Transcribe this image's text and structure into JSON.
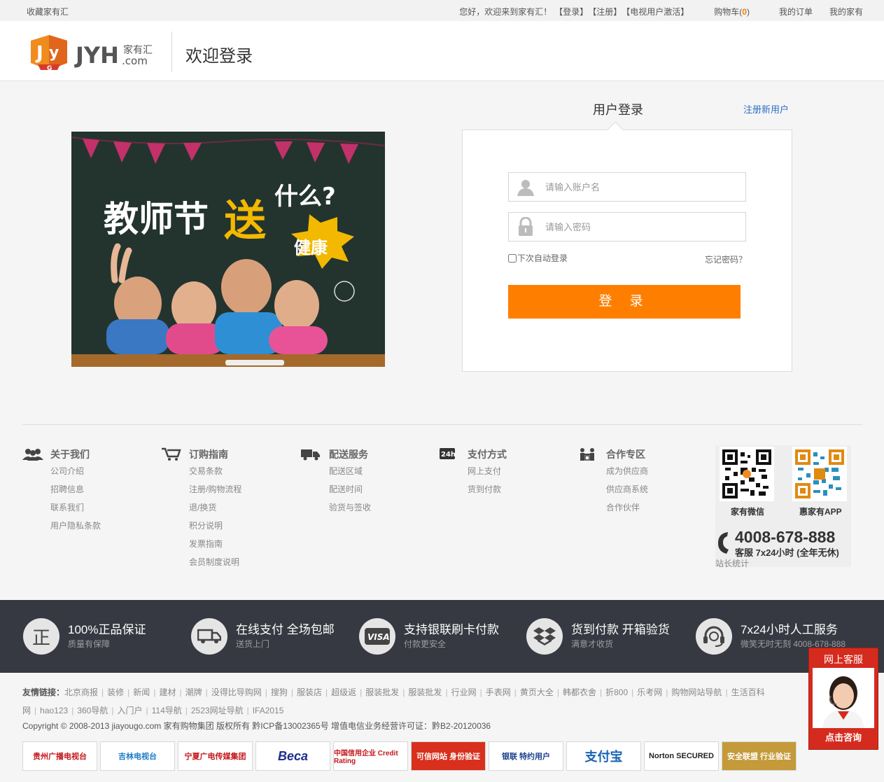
{
  "topbar": {
    "bookmark": "收藏家有汇",
    "greeting": "您好，欢迎来到家有汇！",
    "login": "【登录】",
    "register": "【注册】",
    "tv_activate": "【电视用户激活】",
    "cart_label": "购物车(",
    "cart_count": "0",
    "cart_close": ")",
    "my_orders": "我的订单",
    "my_home": "我的家有"
  },
  "header": {
    "logo_text": "JYH",
    "logo_sub": "家有汇",
    "logo_com": ".com",
    "title": "欢迎登录"
  },
  "banner": {
    "headline_1": "教师节",
    "headline_2": "送",
    "headline_3": "什么?",
    "burst": "健康"
  },
  "login": {
    "tab": "用户登录",
    "register_link": "注册新用户",
    "username_placeholder": "请输入账户名",
    "password_placeholder": "请输入密码",
    "remember": "下次自动登录",
    "forgot": "忘记密码？",
    "submit": "登 录"
  },
  "footer": {
    "columns": [
      {
        "title": "关于我们",
        "icon": "people-icon",
        "items": [
          "公司介绍",
          "招聘信息",
          "联系我们",
          "用户隐私条款"
        ]
      },
      {
        "title": "订购指南",
        "icon": "cart-icon",
        "items": [
          "交易条款",
          "注册/购物流程",
          "退/换货",
          "积分说明",
          "发票指南",
          "会员制度说明"
        ]
      },
      {
        "title": "配送服务",
        "icon": "truck-icon",
        "items": [
          "配送区域",
          "配送时间",
          "验货与签收"
        ]
      },
      {
        "title": "支付方式",
        "icon": "24h-icon",
        "items": [
          "网上支付",
          "货到付款"
        ]
      },
      {
        "title": "合作专区",
        "icon": "handshake-icon",
        "items": [
          "成为供应商",
          "供应商系统",
          "合作伙伴"
        ]
      }
    ],
    "qr1_label": "家有微信",
    "qr2_label": "惠家有APP",
    "phone": "4008-678-888",
    "service": "客服 7x24小时 (全年无休)",
    "stats": "站长统计"
  },
  "features": [
    {
      "icon": "zheng-icon",
      "title": "100%正品保证",
      "sub": "质量有保障"
    },
    {
      "icon": "truck-icon",
      "title": "在线支付 全场包邮",
      "sub": "送货上门"
    },
    {
      "icon": "visa-icon",
      "title": "支持银联刷卡付款",
      "sub": "付款更安全"
    },
    {
      "icon": "box-icon",
      "title": "货到付款 开箱验货",
      "sub": "满意才收货"
    },
    {
      "icon": "headset-icon",
      "title": "7x24小时人工服务",
      "sub": "微笑无时无刻 4008-678-888"
    }
  ],
  "friends": {
    "label": "友情链接：",
    "links": [
      "北京商报",
      "装修",
      "新闻",
      "建材",
      "潮牌",
      "没得比导购网",
      "搜狗",
      "服装店",
      "超级返",
      "服装批发",
      "服装批发",
      "行业网",
      "手表网",
      "黄页大全",
      "韩都衣舍",
      "折800",
      "乐考网",
      "购物网站导航",
      "生活百科网",
      "hao123",
      "360导航",
      "入门户",
      "114导航",
      "2523网址导航",
      "IFA2015"
    ]
  },
  "copyright": "Copyright © 2008-2013 jiayougo.com 家有购物集团 版权所有 黔ICP备13002365号 增值电信业务经营许可证：黔B2-20120036",
  "badges": [
    "贵州广播电视台",
    "吉林电视台",
    "宁夏广电传媒集团",
    "Beca",
    "中国信用企业 Credit Rating",
    "可信网站 身份验证",
    "银联 特约用户",
    "支付宝",
    "Norton SECURED",
    "安全联盟 行业验证"
  ],
  "float_service": {
    "title": "网上客服",
    "button": "点击咨询"
  },
  "colors": {
    "accent": "#fe7f00",
    "link": "#2b6fc7",
    "band": "#363941",
    "float": "#d52b1e"
  }
}
